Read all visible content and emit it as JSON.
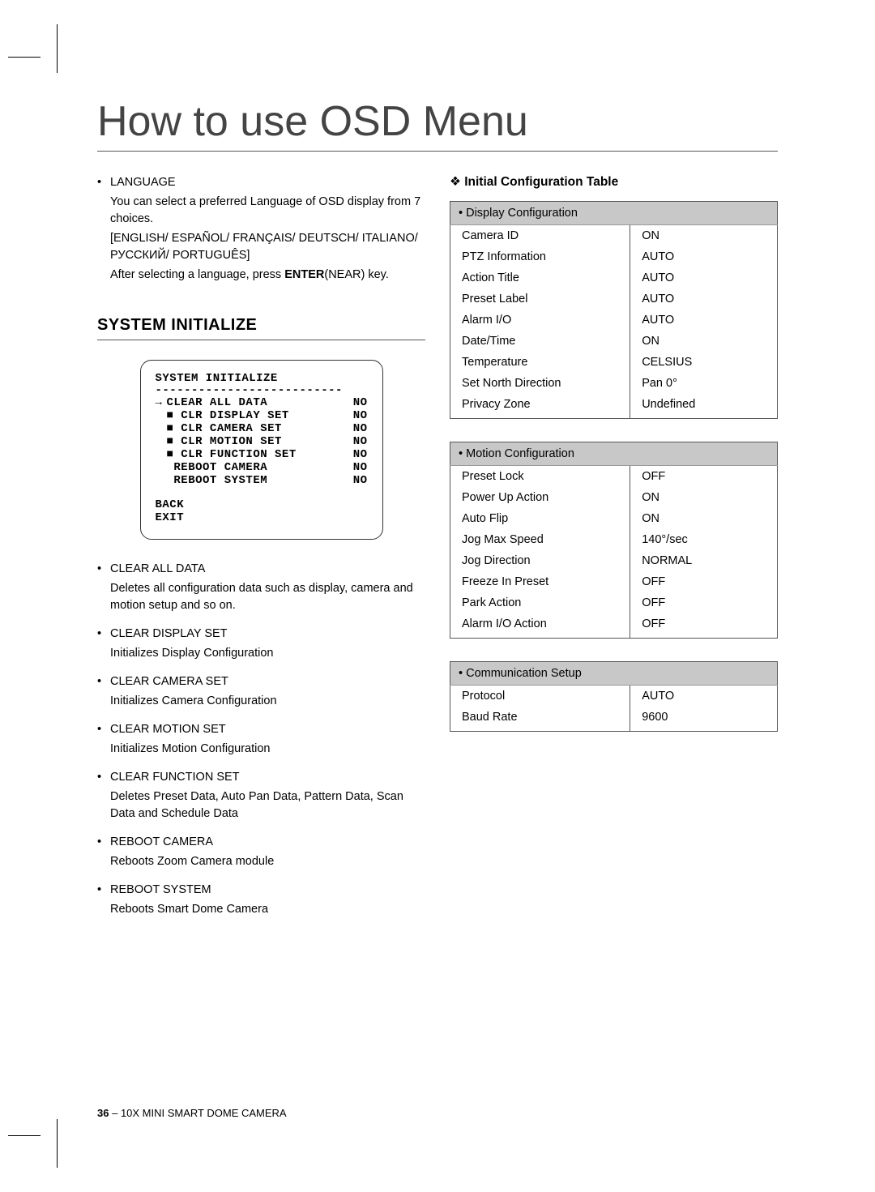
{
  "page_title": "How to use OSD Menu",
  "left": {
    "language": {
      "label": "LANGUAGE",
      "desc1": "You can select a preferred Language of OSD display from 7 choices.",
      "desc2": "[ENGLISH/ ESPAÑOL/ FRANÇAIS/ DEUTSCH/ ITALIANO/ РУССКИЙ/ PORTUGUÊS]",
      "desc3a": "After selecting a language, press ",
      "desc3b": "ENTER",
      "desc3c": "(NEAR) key."
    },
    "section_title": "SYSTEM INITIALIZE",
    "osd": {
      "title": "SYSTEM INITIALIZE",
      "rows": [
        {
          "arrow": "→",
          "sq": "",
          "label": "CLEAR ALL DATA",
          "val": "NO"
        },
        {
          "arrow": "",
          "sq": "■",
          "label": " CLR DISPLAY SET",
          "val": "NO"
        },
        {
          "arrow": "",
          "sq": "■",
          "label": " CLR CAMERA SET",
          "val": "NO"
        },
        {
          "arrow": "",
          "sq": "■",
          "label": " CLR MOTION SET",
          "val": "NO"
        },
        {
          "arrow": "",
          "sq": "■",
          "label": " CLR FUNCTION SET",
          "val": "NO"
        },
        {
          "arrow": "",
          "sq": "",
          "label": " REBOOT CAMERA",
          "val": "NO"
        },
        {
          "arrow": "",
          "sq": "",
          "label": " REBOOT SYSTEM",
          "val": "NO"
        }
      ],
      "back": "BACK",
      "exit": "EXIT"
    },
    "items": [
      {
        "title": "CLEAR ALL DATA",
        "desc": "Deletes all configuration data such as display, camera and motion setup and so on."
      },
      {
        "title": "CLEAR DISPLAY SET",
        "desc": "Initializes Display Configuration"
      },
      {
        "title": "CLEAR CAMERA SET",
        "desc": "Initializes Camera Configuration"
      },
      {
        "title": "CLEAR MOTION SET",
        "desc": "Initializes Motion Configuration"
      },
      {
        "title": "CLEAR FUNCTION SET",
        "desc": "Deletes Preset Data, Auto Pan Data, Pattern Data, Scan Data and Schedule Data"
      },
      {
        "title": "REBOOT CAMERA",
        "desc": "Reboots Zoom Camera module"
      },
      {
        "title": "REBOOT SYSTEM",
        "desc": "Reboots Smart Dome Camera"
      }
    ]
  },
  "right": {
    "heading": "Initial Configuration Table",
    "tables": [
      {
        "header": "Display Configuration",
        "rows": [
          [
            "Camera ID",
            "ON"
          ],
          [
            "PTZ Information",
            "AUTO"
          ],
          [
            "Action Title",
            "AUTO"
          ],
          [
            "Preset Label",
            "AUTO"
          ],
          [
            "Alarm I/O",
            "AUTO"
          ],
          [
            "Date/Time",
            "ON"
          ],
          [
            "Temperature",
            "CELSIUS"
          ],
          [
            "Set North Direction",
            "Pan 0°"
          ],
          [
            "Privacy Zone",
            "Undefined"
          ]
        ]
      },
      {
        "header": "Motion Configuration",
        "rows": [
          [
            "Preset Lock",
            "OFF"
          ],
          [
            "Power Up Action",
            "ON"
          ],
          [
            "Auto Flip",
            "ON"
          ],
          [
            "Jog Max Speed",
            "140°/sec"
          ],
          [
            "Jog Direction",
            "NORMAL"
          ],
          [
            "Freeze In Preset",
            "OFF"
          ],
          [
            "Park Action",
            "OFF"
          ],
          [
            "Alarm I/O Action",
            "OFF"
          ]
        ]
      },
      {
        "header": "Communication Setup",
        "rows": [
          [
            "Protocol",
            "AUTO"
          ],
          [
            "Baud Rate",
            "9600"
          ]
        ]
      }
    ]
  },
  "footer": {
    "page": "36",
    "sep": " – ",
    "product": "10X MINI SMART DOME CAMERA"
  }
}
